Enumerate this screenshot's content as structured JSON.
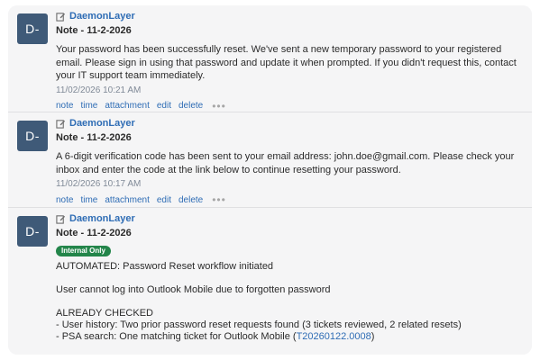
{
  "notes": [
    {
      "avatar": "D-",
      "author": "DaemonLayer",
      "title": "Note - 11-2-2026",
      "text": "Your password has been successfully reset. We've sent a new temporary password to your registered email. Please sign in using that password and update it when prompted. If you didn't request this, contact your IT support team immediately.",
      "timestamp": "11/02/2026 10:21 AM",
      "actions": [
        "note",
        "time",
        "attachment",
        "edit",
        "delete"
      ]
    },
    {
      "avatar": "D-",
      "author": "DaemonLayer",
      "title": "Note - 11-2-2026",
      "text": "A 6-digit verification code has been sent to your email address: john.doe@gmail.com. Please check your inbox and enter the code at the link below to continue resetting your password.",
      "timestamp": "11/02/2026 10:17 AM",
      "actions": [
        "note",
        "time",
        "attachment",
        "edit",
        "delete"
      ]
    },
    {
      "avatar": "D-",
      "author": "DaemonLayer",
      "title": "Note - 11-2-2026",
      "badge": "Internal Only",
      "lines": [
        "AUTOMATED: Password Reset workflow initiated",
        "",
        "User cannot log into Outlook Mobile due to forgotten password",
        "",
        "ALREADY CHECKED",
        "- User history: Two prior password reset requests found (3 tickets reviewed, 2 related resets)"
      ],
      "last_line_prefix": "- PSA search: One matching ticket for Outlook Mobile (",
      "ticket_link": "T20260122.0008",
      "last_line_suffix": ")"
    }
  ],
  "colors": {
    "avatar_bg": "#3f5a78",
    "link": "#2f6db5",
    "badge_bg": "#23854a",
    "panel_bg": "#f5f5f6"
  },
  "icons": {
    "edit": "pencil-edit-icon",
    "more": "more-dots-icon"
  }
}
